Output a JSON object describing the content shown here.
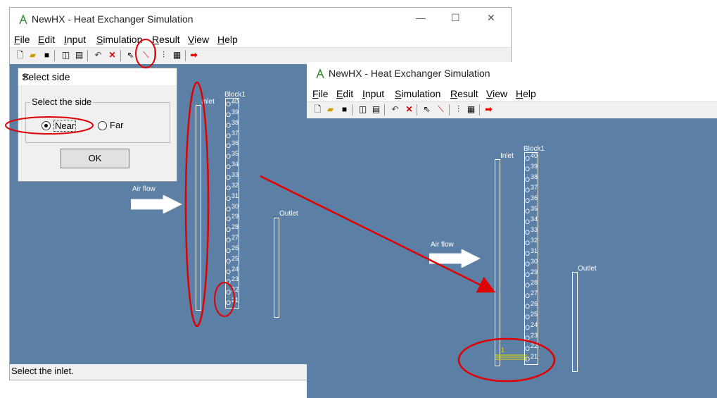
{
  "app": {
    "title": "NewHX - Heat Exchanger Simulation",
    "menu": [
      "File",
      "Edit",
      "Input",
      "Simulation",
      "Result",
      "View",
      "Help"
    ],
    "menu_access_keys": [
      "F",
      "E",
      "I",
      "S",
      "R",
      "V",
      "H"
    ],
    "status": "Select the inlet.",
    "window_controls": [
      "minimize-icon",
      "maximize-icon",
      "close-icon"
    ]
  },
  "toolbar_icons": [
    "new-file-icon",
    "open-folder-icon",
    "save-icon",
    "print-preview-icon",
    "print-icon",
    "undo-icon",
    "delete-icon",
    "select-arrow-icon",
    "connect-tube-icon",
    "split-icon",
    "block-icon",
    "run-arrow-icon"
  ],
  "dialog": {
    "title": "Select side",
    "group_label": "Select the side",
    "options": [
      "Near",
      "Far"
    ],
    "selected": "Near",
    "ok_label": "OK"
  },
  "diagram": {
    "inlet_label": "Inlet",
    "outlet_label": "Outlet",
    "block_label": "Block1",
    "air_flow_label": "Air flow",
    "tube_numbers": [
      "40",
      "39",
      "38",
      "37",
      "36",
      "35",
      "34",
      "33",
      "32",
      "31",
      "30",
      "29",
      "28",
      "27",
      "26",
      "25",
      "24",
      "23",
      "22",
      "21"
    ],
    "tube_letter": "O",
    "connection_number": "1"
  },
  "colors": {
    "canvas": "#5b7fa5",
    "annotation": "#e00000",
    "connection": "#e8e000"
  }
}
